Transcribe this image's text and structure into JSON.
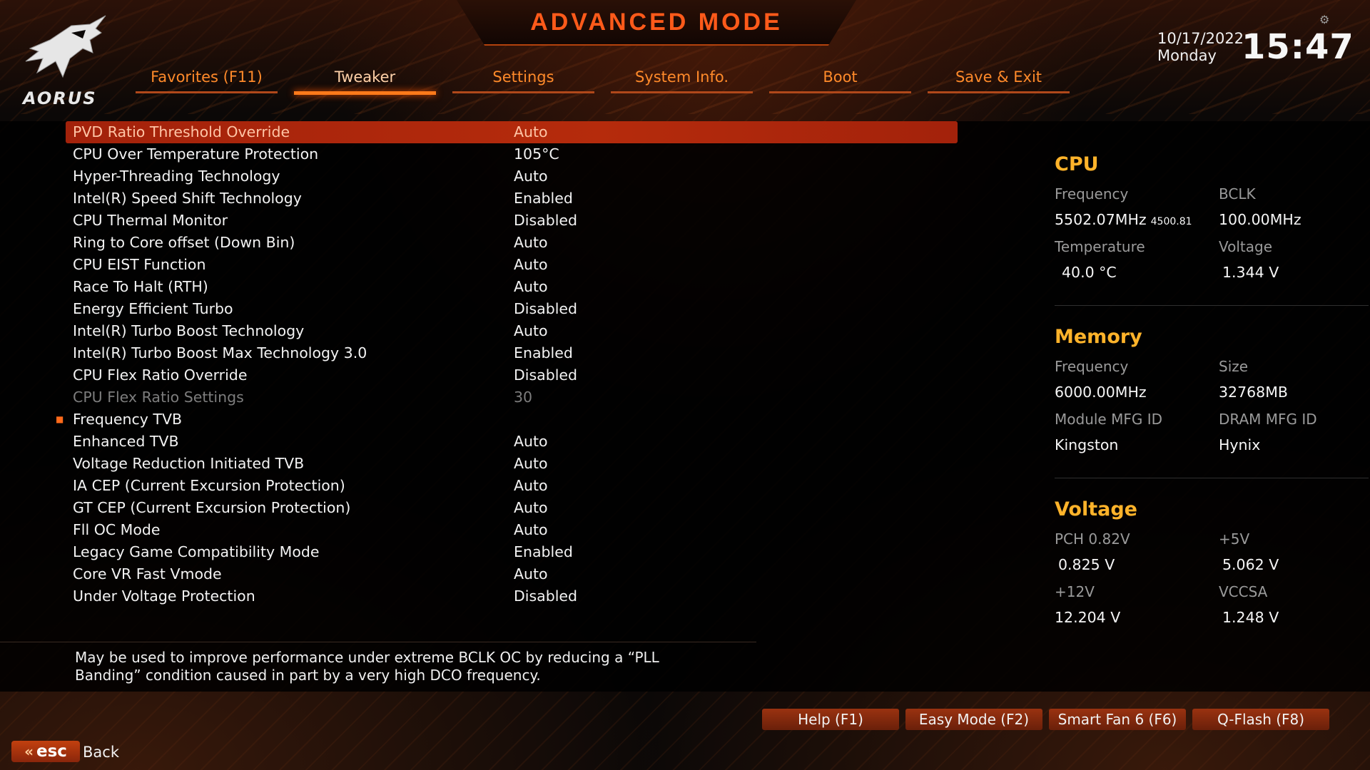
{
  "header": {
    "title": "ADVANCED MODE",
    "logo_text": "AORUS",
    "date": "10/17/2022",
    "day": "Monday",
    "time": "15:47"
  },
  "tabs": [
    {
      "label": "Favorites (F11)",
      "active": false
    },
    {
      "label": "Tweaker",
      "active": true
    },
    {
      "label": "Settings",
      "active": false
    },
    {
      "label": "System Info.",
      "active": false
    },
    {
      "label": "Boot",
      "active": false
    },
    {
      "label": "Save & Exit",
      "active": false
    }
  ],
  "settings": [
    {
      "label": "PVD Ratio Threshold Override",
      "value": "Auto"
    },
    {
      "label": "CPU Over Temperature Protection",
      "value": "105°C"
    },
    {
      "label": "Hyper-Threading Technology",
      "value": "Auto"
    },
    {
      "label": "Intel(R) Speed Shift Technology",
      "value": "Enabled"
    },
    {
      "label": "CPU Thermal Monitor",
      "value": "Disabled"
    },
    {
      "label": "Ring to Core offset (Down Bin)",
      "value": "Auto"
    },
    {
      "label": "CPU EIST Function",
      "value": "Auto"
    },
    {
      "label": "Race To Halt (RTH)",
      "value": "Auto"
    },
    {
      "label": "Energy Efficient Turbo",
      "value": "Disabled"
    },
    {
      "label": "Intel(R) Turbo Boost Technology",
      "value": "Auto"
    },
    {
      "label": "Intel(R) Turbo Boost Max Technology 3.0",
      "value": "Enabled"
    },
    {
      "label": "CPU Flex Ratio Override",
      "value": "Disabled"
    },
    {
      "label": "CPU Flex Ratio Settings",
      "value": "30"
    },
    {
      "label": "Frequency TVB",
      "value": ""
    },
    {
      "label": "Enhanced TVB",
      "value": "Auto"
    },
    {
      "label": "Voltage Reduction Initiated TVB",
      "value": "Auto"
    },
    {
      "label": "IA CEP (Current Excursion Protection)",
      "value": "Auto"
    },
    {
      "label": "GT CEP (Current Excursion Protection)",
      "value": "Auto"
    },
    {
      "label": "Fll OC Mode",
      "value": "Auto"
    },
    {
      "label": "Legacy Game Compatibility Mode",
      "value": "Enabled"
    },
    {
      "label": "Core VR Fast Vmode",
      "value": "Auto"
    },
    {
      "label": "Under Voltage Protection",
      "value": "Disabled"
    }
  ],
  "help_text": "May be used to improve performance under extreme BCLK OC by reducing a “PLL Banding” condition caused in part by a very high DCO frequency.",
  "cpu": {
    "title": "CPU",
    "frequency_label": "Frequency",
    "frequency_value": "5502.07MHz",
    "frequency_sub": "4500.81",
    "bclk_label": "BCLK",
    "bclk_value": "100.00MHz",
    "temperature_label": "Temperature",
    "temperature_value": "40.0 °C",
    "voltage_label": "Voltage",
    "voltage_value": "1.344 V"
  },
  "memory": {
    "title": "Memory",
    "frequency_label": "Frequency",
    "frequency_value": "6000.00MHz",
    "size_label": "Size",
    "size_value": "32768MB",
    "module_label": "Module MFG ID",
    "module_value": "Kingston",
    "dram_label": "DRAM MFG ID",
    "dram_value": "Hynix"
  },
  "voltage": {
    "title": "Voltage",
    "pch_label": "PCH 0.82V",
    "pch_value": "0.825 V",
    "v5_label": "+5V",
    "v5_value": "5.062 V",
    "v12_label": "+12V",
    "v12_value": "12.204 V",
    "vccsa_label": "VCCSA",
    "vccsa_value": "1.248 V"
  },
  "function_keys": [
    "Help (F1)",
    "Easy Mode (F2)",
    "Smart Fan 6 (F6)",
    "Q-Flash (F8)"
  ],
  "esc": {
    "key": "esc",
    "label": "Back"
  },
  "colors": {
    "accent": "#ff7a1a",
    "selected_row": "#b52b0c",
    "section_title": "#ffb32a"
  },
  "icons": {
    "gear": "gear-icon",
    "back": "chevron-left-icon",
    "logo": "aorus-eagle-logo"
  }
}
